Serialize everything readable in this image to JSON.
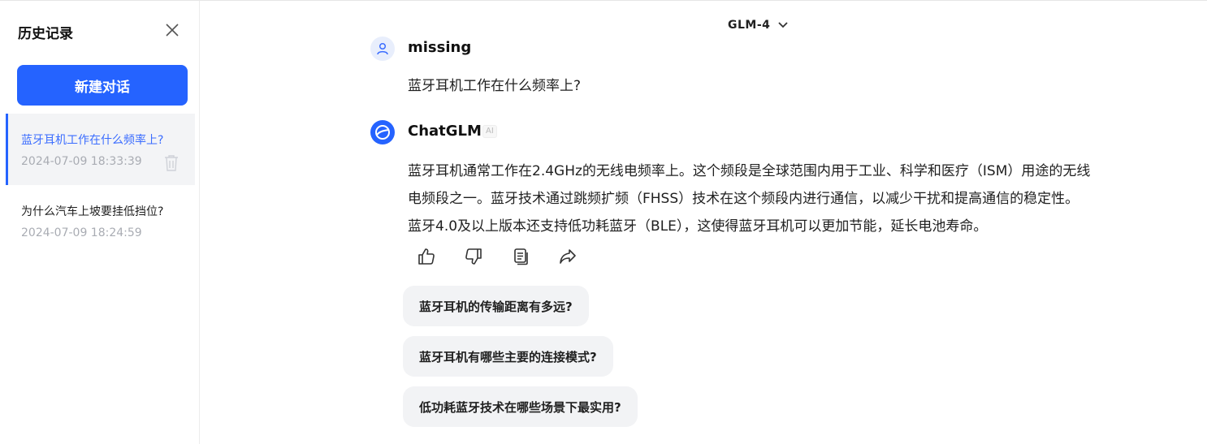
{
  "sidebar": {
    "title": "历史记录",
    "new_chat_label": "新建对话",
    "items": [
      {
        "title": "蓝牙耳机工作在什么频率上?",
        "time": "2024-07-09 18:33:39"
      },
      {
        "title": "为什么汽车上坡要挂低挡位?",
        "time": "2024-07-09 18:24:59"
      }
    ]
  },
  "header": {
    "model": "GLM-4"
  },
  "conversation": {
    "user": {
      "name": "missing",
      "text": "蓝牙耳机工作在什么频率上?"
    },
    "bot": {
      "name": "ChatGLM",
      "badge": "AI",
      "lines": [
        "蓝牙耳机通常工作在2.4GHz的无线电频率上。这个频段是全球范围内用于工业、科学和医疗（ISM）用途的无线",
        "电频段之一。蓝牙技术通过跳频扩频（FHSS）技术在这个频段内进行通信，以减少干扰和提高通信的稳定性。",
        "蓝牙4.0及以上版本还支持低功耗蓝牙（BLE），这使得蓝牙耳机可以更加节能，延长电池寿命。"
      ]
    },
    "actions": [
      "thumbs-up-icon",
      "thumbs-down-icon",
      "copy-icon",
      "share-icon"
    ]
  },
  "suggestions": [
    "蓝牙耳机的传输距离有多远?",
    "蓝牙耳机有哪些主要的连接模式?",
    "低功耗蓝牙技术在哪些场景下最实用?"
  ],
  "colors": {
    "accent": "#2563ff",
    "active_text": "#3b6dff",
    "muted": "#a9acb3"
  }
}
